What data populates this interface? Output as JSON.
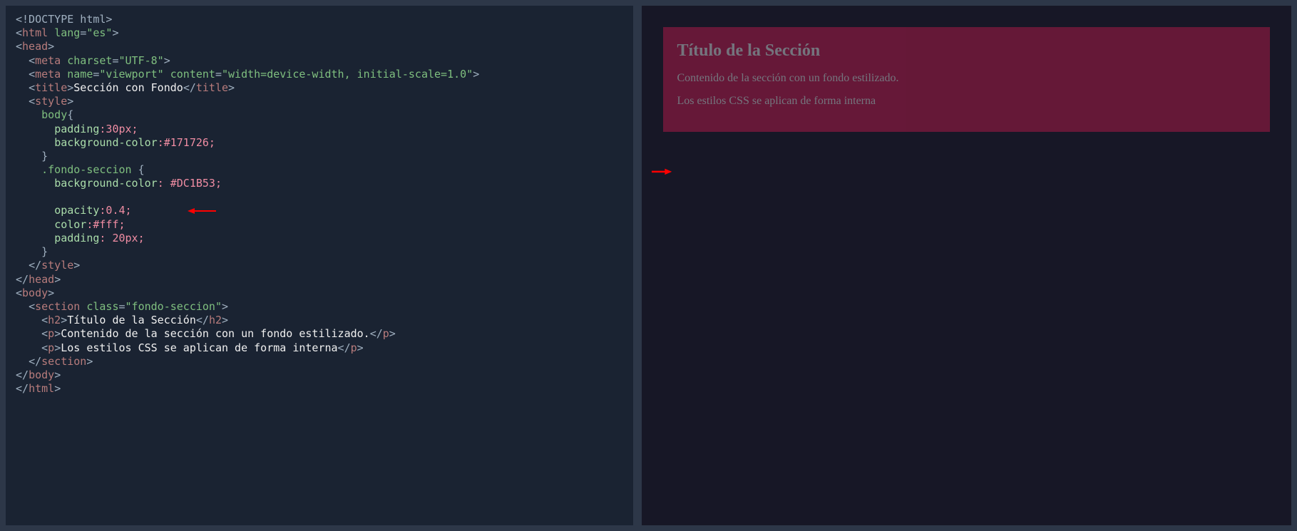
{
  "code": {
    "doctype": "<!DOCTYPE html>",
    "html_open": "<",
    "html_tag": "html",
    "lang_attr": "lang",
    "lang_val": "\"es\"",
    "head_open": "<",
    "head_tag": "head",
    "meta_tag": "meta",
    "charset_attr": "charset",
    "charset_val": "\"UTF-8\"",
    "name_attr": "name",
    "viewport_val": "\"viewport\"",
    "content_attr": "content",
    "content_val": "\"width=device-width, initial-scale=1.0\"",
    "title_tag": "title",
    "title_text": "Sección con Fondo",
    "style_tag": "style",
    "body_selector": "body",
    "padding_prop": "padding",
    "padding_val": ":30px;",
    "bg_prop": "background-color",
    "bg_body_val": ":#171726;",
    "class_selector": ".fondo-seccion",
    "bg_class_val": ": #DC1B53;",
    "opacity_prop": "opacity",
    "opacity_val": ":0.4;",
    "color_prop": "color",
    "color_val": ":#fff;",
    "padding_class_val": ": 20px;",
    "body_tag": "body",
    "section_tag": "section",
    "class_attr": "class",
    "class_val": "\"fondo-seccion\"",
    "h2_tag": "h2",
    "h2_text": "Título de la Sección",
    "p_tag": "p",
    "p1_text": "Contenido de la sección con un fondo estilizado.",
    "p2_text": "Los estilos CSS se aplican de forma interna",
    "gt": ">",
    "lt_slash": "</",
    "open_brace": " {",
    "close_brace": "}",
    "self_close": ">"
  },
  "preview": {
    "heading": "Título de la Sección",
    "para1": "Contenido de la sección con un fondo estilizado.",
    "para2": "Los estilos CSS se aplican de forma interna"
  },
  "arrows": {
    "inline": "←——",
    "outer": "↗"
  }
}
